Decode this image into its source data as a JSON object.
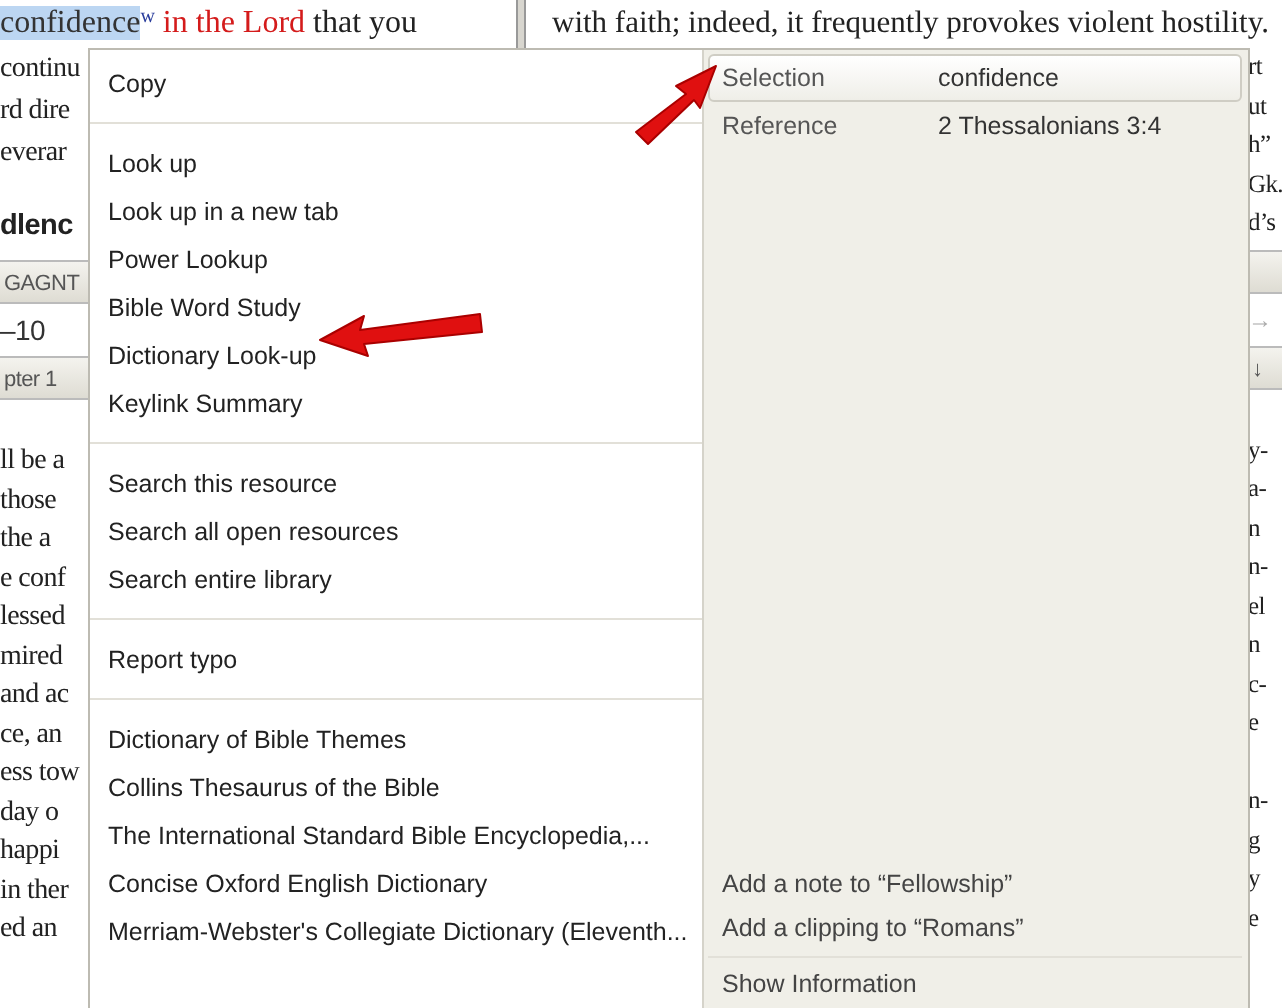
{
  "document_left": {
    "first_line": [
      {
        "kind": "highlight",
        "text": "confidence"
      },
      {
        "kind": "sup",
        "text": "w"
      },
      {
        "kind": "red",
        "text": " in the Lord"
      },
      {
        "kind": "plain",
        "text": " that you"
      }
    ],
    "lines": [
      {
        "kind": "text",
        "text": "continu"
      },
      {
        "kind": "text",
        "text": "rd dire"
      },
      {
        "kind": "text",
        "text": "everar"
      },
      {
        "kind": "gap"
      },
      {
        "kind": "heading",
        "text": "dlenc"
      },
      {
        "kind": "toolbar",
        "text": "GAGNT"
      },
      {
        "kind": "field",
        "text": "–10"
      },
      {
        "kind": "toolbar",
        "text": "pter 1"
      },
      {
        "kind": "gap"
      },
      {
        "kind": "text",
        "text": "ll be a"
      },
      {
        "kind": "text",
        "text": "those"
      },
      {
        "kind": "text",
        "text": " the a"
      },
      {
        "kind": "text",
        "text": "e conf"
      },
      {
        "kind": "text",
        "text": "lessed"
      },
      {
        "kind": "text",
        "text": "mired"
      },
      {
        "kind": "text",
        "text": "and ac"
      },
      {
        "kind": "text",
        "text": "ce, an"
      },
      {
        "kind": "text",
        "text": "ess tow"
      },
      {
        "kind": "text",
        "text": " day o"
      },
      {
        "kind": "text",
        "text": " happi"
      },
      {
        "kind": "text",
        "text": "in ther"
      },
      {
        "kind": "text",
        "text": "ed an"
      }
    ]
  },
  "document_right": {
    "first_line": "with faith; indeed, it frequently provokes violent hostility.",
    "lines": [
      {
        "kind": "text",
        "text": "rt"
      },
      {
        "kind": "text",
        "text": "ut"
      },
      {
        "kind": "text",
        "text": "h”"
      },
      {
        "kind": "text",
        "text": "Gk."
      },
      {
        "kind": "text",
        "text": "d’s"
      },
      {
        "kind": "toolbar"
      },
      {
        "kind": "field",
        "text": "→"
      },
      {
        "kind": "toolbar",
        "text": "↓"
      },
      {
        "kind": "gap"
      },
      {
        "kind": "text",
        "text": "y-"
      },
      {
        "kind": "text",
        "text": "a-"
      },
      {
        "kind": "text",
        "text": "n"
      },
      {
        "kind": "text",
        "text": "n-"
      },
      {
        "kind": "text",
        "text": "el"
      },
      {
        "kind": "text",
        "text": "n"
      },
      {
        "kind": "text",
        "text": "c-"
      },
      {
        "kind": "text",
        "text": "e"
      },
      {
        "kind": "blank"
      },
      {
        "kind": "text",
        "text": "n-"
      },
      {
        "kind": "text",
        "text": "g"
      },
      {
        "kind": "text",
        "text": "y"
      },
      {
        "kind": "text",
        "text": "e"
      }
    ]
  },
  "context_menu": {
    "groups": [
      [
        "Copy"
      ],
      [
        "Look up",
        "Look up in a new tab",
        "Power Lookup",
        "Bible Word Study",
        "Dictionary Look-up",
        "Keylink Summary"
      ],
      [
        "Search this resource",
        "Search all open resources",
        "Search entire library"
      ],
      [
        "Report typo"
      ],
      [
        "Dictionary of Bible Themes",
        "Collins Thesaurus of the Bible",
        "The International Standard Bible Encyclopedia,...",
        "Concise Oxford English Dictionary",
        "Merriam-Webster's Collegiate Dictionary (Eleventh..."
      ]
    ],
    "info": [
      {
        "label": "Selection",
        "value": "confidence",
        "selected": true
      },
      {
        "label": "Reference",
        "value": "2 Thessalonians 3:4",
        "selected": false
      }
    ],
    "actions": [
      "Add a note to “Fellowship”",
      "Add a clipping to “Romans”"
    ],
    "footer": "Show Information"
  }
}
